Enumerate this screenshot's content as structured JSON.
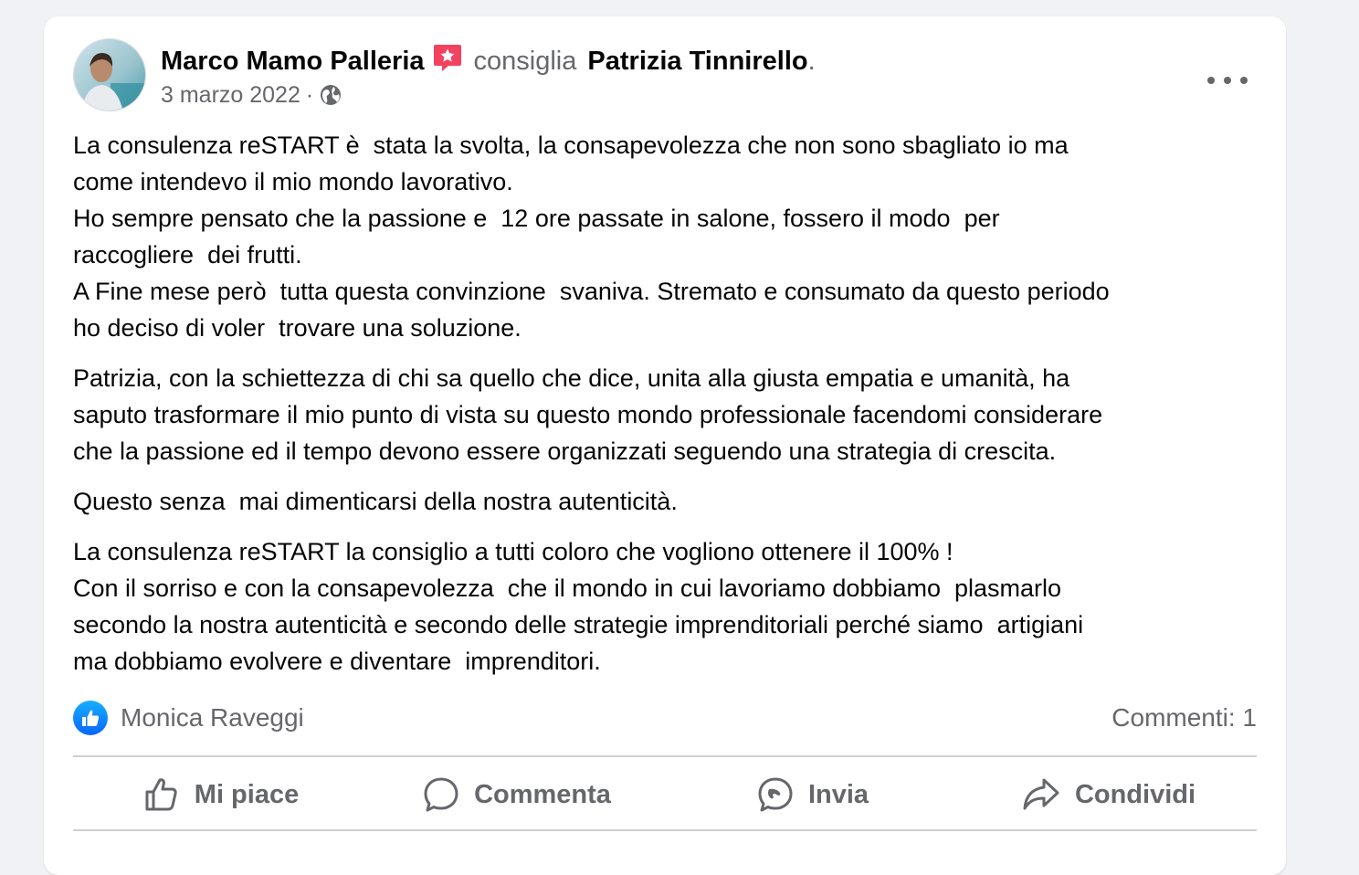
{
  "post": {
    "author": "Marco Mamo Palleria",
    "verb": "consiglia",
    "page": "Patrizia Tinnirello",
    "period": ".",
    "date": "3 marzo 2022",
    "separator": "·",
    "paragraphs": [
      "La consulenza reSTART è  stata la svolta, la consapevolezza che non sono sbagliato io ma\ncome intendevo il mio mondo lavorativo.\nHo sempre pensato che la passione e  12 ore passate in salone, fossero il modo  per\nraccogliere  dei frutti.\nA Fine mese però  tutta questa convinzione  svaniva. Stremato e consumato da questo periodo\nho deciso di voler  trovare una soluzione.",
      "Patrizia, con la schiettezza di chi sa quello che dice, unita alla giusta empatia e umanità, ha\nsaputo trasformare il mio punto di vista su questo mondo professionale facendomi considerare\nche la passione ed il tempo devono essere organizzati seguendo una strategia di crescita.",
      "Questo senza  mai dimenticarsi della nostra autenticità.",
      "La consulenza reSTART la consiglio a tutti coloro che vogliono ottenere il 100% !\nCon il sorriso e con la consapevolezza  che il mondo in cui lavoriamo dobbiamo  plasmarlo\nsecondo la nostra autenticità e secondo delle strategie imprenditoriali perché siamo  artigiani\nma dobbiamo evolvere e diventare  imprenditori."
    ],
    "reactor": "Monica Raveggi",
    "comments_count": "Commenti: 1"
  },
  "actions": {
    "like": "Mi piace",
    "comment": "Commenta",
    "send": "Invia",
    "share": "Condividi"
  },
  "icons": {
    "more": "more-horizontal-icon",
    "globe": "globe-icon",
    "badge": "recommendation-star-icon",
    "like": "thumbs-up-icon",
    "comment": "speech-bubble-icon",
    "send": "messenger-icon",
    "share": "share-arrow-icon"
  },
  "colors": {
    "accent": "#0866ff",
    "badge": "#f3425f",
    "secondary_text": "#65676b"
  }
}
